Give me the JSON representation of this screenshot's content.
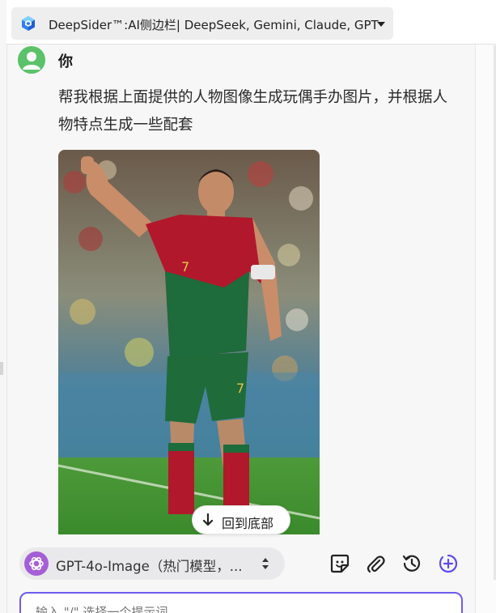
{
  "header": {
    "title": "DeepSider™:AI侧边栏| DeepSeek, Gemini, Claude, GPT",
    "logo_icon": "deepsider-cube-icon",
    "dropdown_icon": "caret-down-icon"
  },
  "message": {
    "sender": "你",
    "avatar_icon": "user-avatar-icon",
    "avatar_color": "#5bc26a",
    "text": "帮我根据上面提供的人物图像生成玩偶手办图片，并根据人物特点生成一些配套",
    "image_icon": "soccer-player-photo"
  },
  "back_to_bottom": {
    "label": "回到底部",
    "icon": "arrow-down-icon"
  },
  "model": {
    "name": "GPT-4o-Image（热门模型，...",
    "icon": "openai-logo-icon",
    "icon_color": "#a55fd6"
  },
  "toolbar": {
    "sticker_icon": "sticker-icon",
    "attach_icon": "paperclip-icon",
    "history_icon": "history-icon",
    "new_chat_icon": "plus-circle-icon",
    "accent": "#5a4cf0"
  },
  "input": {
    "placeholder": "输入 \"/\" 选择一个提示词"
  }
}
